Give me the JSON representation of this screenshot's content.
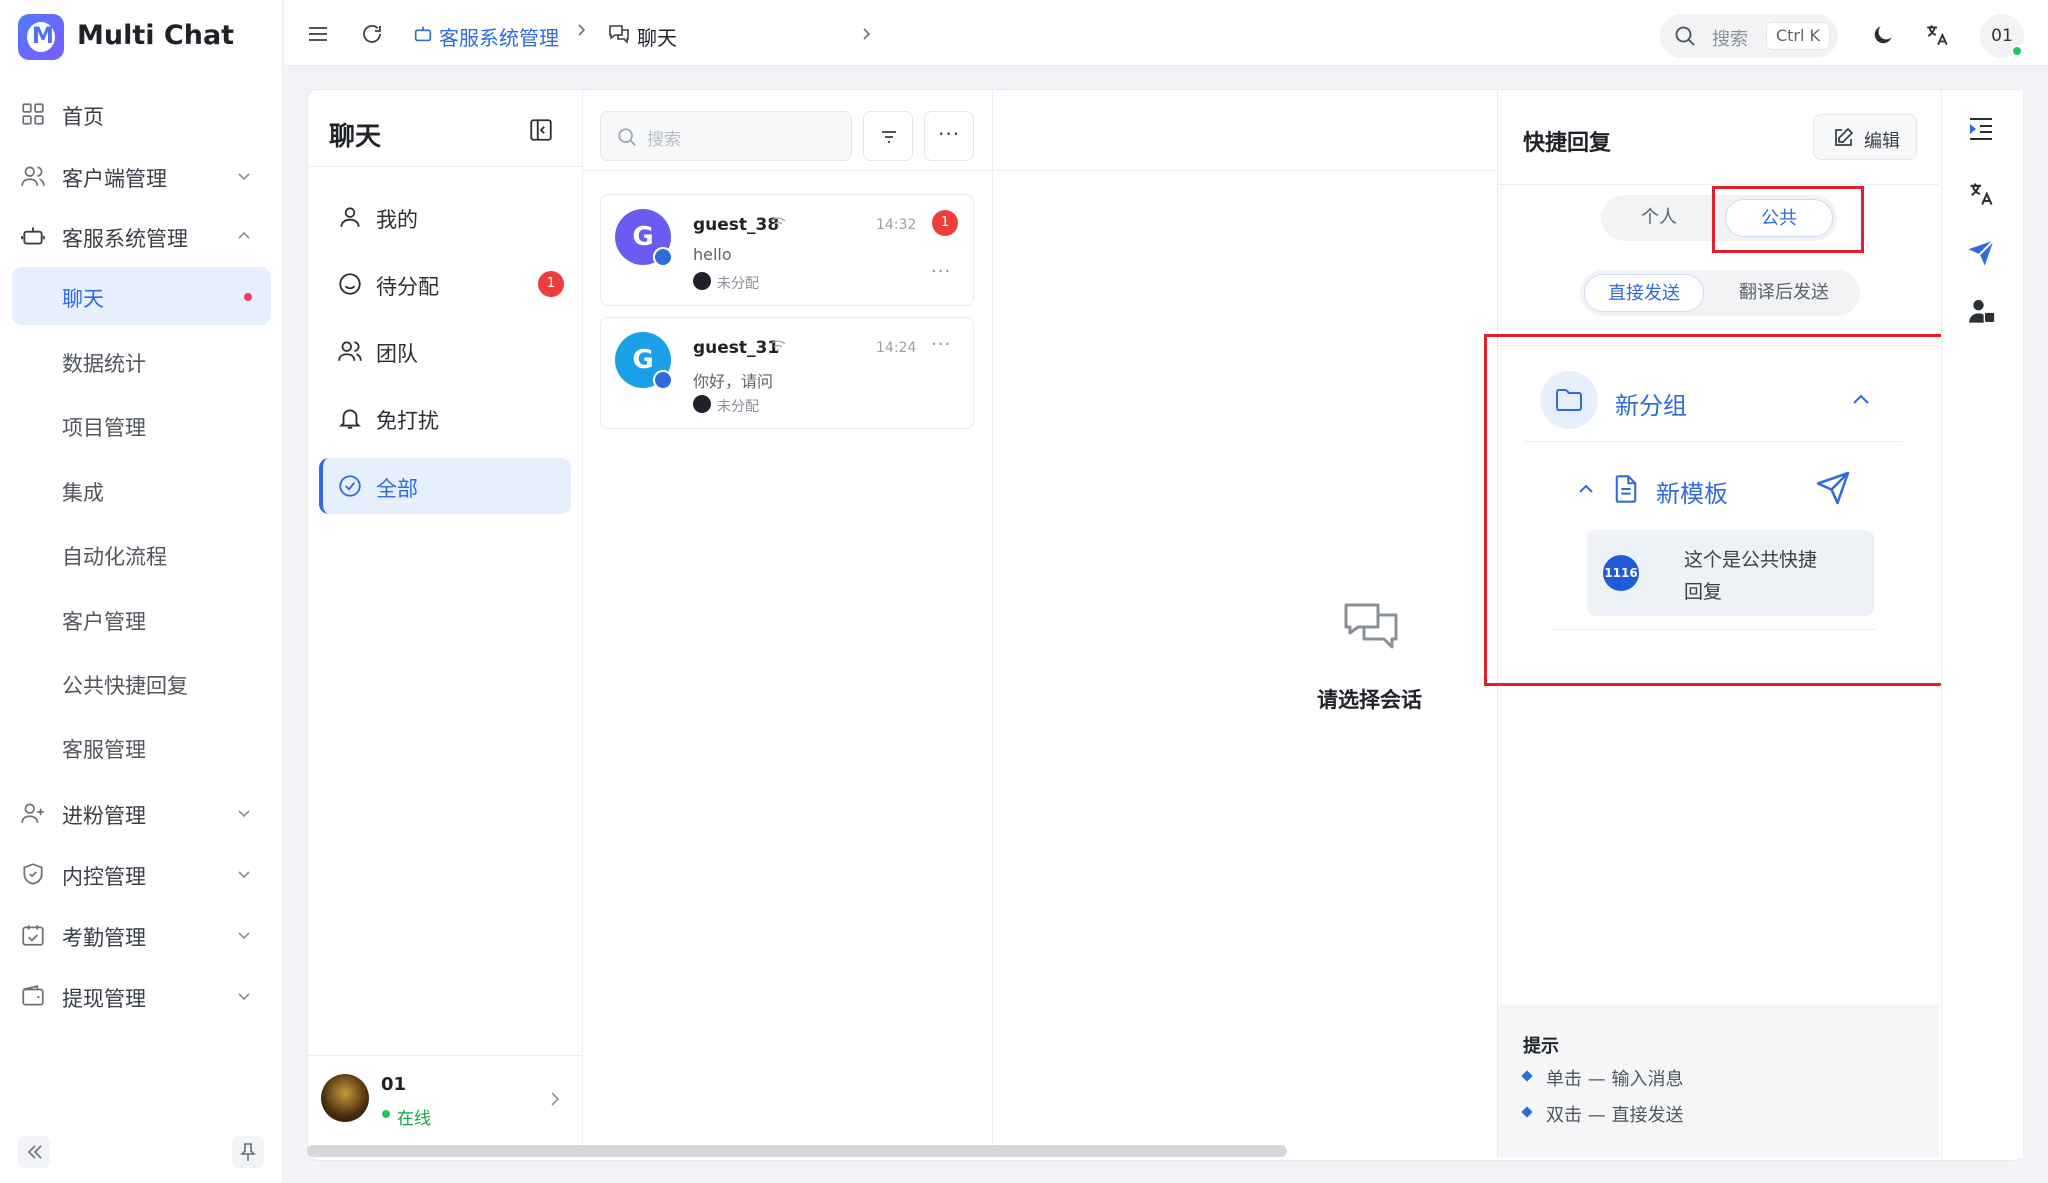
{
  "app": {
    "title": "Multi Chat",
    "logo_letter": "M"
  },
  "sidebar": {
    "items": [
      {
        "label": "首页",
        "icon": "dashboard-icon"
      },
      {
        "label": "客户端管理",
        "icon": "users-icon",
        "expandable": true
      },
      {
        "label": "客服系统管理",
        "icon": "robot-icon",
        "expandable": true,
        "expanded": true
      },
      {
        "label": "进粉管理",
        "icon": "user-plus-icon",
        "expandable": true
      },
      {
        "label": "内控管理",
        "icon": "shield-icon",
        "expandable": true
      },
      {
        "label": "考勤管理",
        "icon": "calendar-check-icon",
        "expandable": true
      },
      {
        "label": "提现管理",
        "icon": "wallet-icon",
        "expandable": true
      }
    ],
    "sub_items": [
      {
        "label": "聊天",
        "active": true,
        "unread_dot": true
      },
      {
        "label": "数据统计"
      },
      {
        "label": "项目管理"
      },
      {
        "label": "集成"
      },
      {
        "label": "自动化流程"
      },
      {
        "label": "客户管理"
      },
      {
        "label": "公共快捷回复"
      },
      {
        "label": "客服管理"
      }
    ]
  },
  "header": {
    "breadcrumb": [
      {
        "label": "客服系统管理",
        "icon": "robot-icon"
      },
      {
        "label": "聊天",
        "icon": "chat-icon"
      }
    ],
    "search_label": "搜索",
    "search_shortcut": "Ctrl K",
    "user_initials": "01"
  },
  "chat_panel": {
    "title": "聊天",
    "folders": [
      {
        "label": "我的",
        "icon": "user-icon"
      },
      {
        "label": "待分配",
        "icon": "smile-icon",
        "badge": "1"
      },
      {
        "label": "团队",
        "icon": "team-icon"
      },
      {
        "label": "免打扰",
        "icon": "bell-icon"
      },
      {
        "label": "全部",
        "icon": "check-circle-icon",
        "active": true
      }
    ],
    "agent": {
      "name": "01",
      "status": "在线"
    }
  },
  "conversation_list": {
    "search_placeholder": "搜索",
    "items": [
      {
        "avatar_letter": "G",
        "avatar_color": "#6a5cf0",
        "name": "guest_38",
        "time": "14:32",
        "message": "hello",
        "status": "未分配",
        "unread": "1"
      },
      {
        "avatar_letter": "G",
        "avatar_color": "#1aa0e8",
        "name": "guest_31",
        "time": "14:24",
        "message": "你好，请问",
        "status": "未分配"
      }
    ]
  },
  "empty_state": {
    "text": "请选择会话"
  },
  "quick_reply": {
    "title": "快捷回复",
    "edit_label": "编辑",
    "scope_tabs": [
      {
        "label": "个人"
      },
      {
        "label": "公共",
        "active": true
      }
    ],
    "send_tabs": [
      {
        "label": "直接发送",
        "active": true
      },
      {
        "label": "翻译后发送"
      }
    ],
    "group": {
      "name": "新分组",
      "expanded": true
    },
    "template": {
      "name": "新模板",
      "expanded": true,
      "item_badge": "1116",
      "item_text_line1": "这个是公共快捷",
      "item_text_line2": "回复"
    },
    "hint": {
      "title": "提示",
      "lines": [
        "单击 — 输入消息",
        "双击 — 直接发送"
      ]
    }
  },
  "colors": {
    "accent": "#2f6bdb",
    "danger": "#ee3d3d",
    "highlight_box": "#e3202a",
    "online": "#22c55e"
  }
}
